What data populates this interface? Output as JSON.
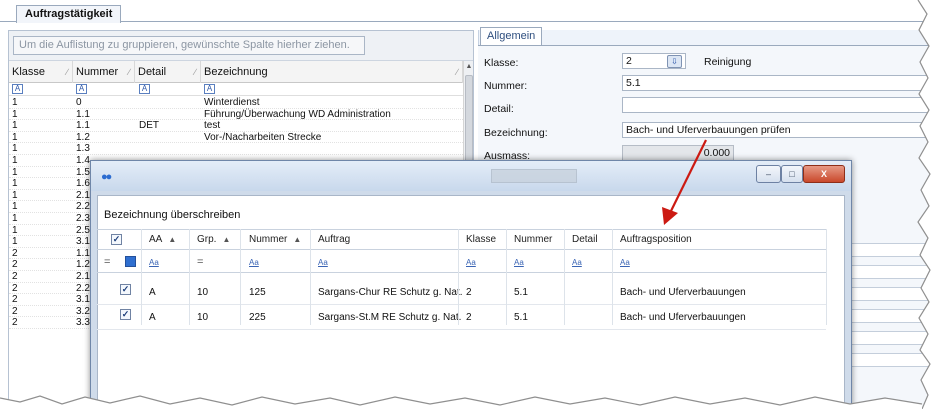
{
  "tabs": {
    "main": "Auftragstätigkeit"
  },
  "left_grid": {
    "group_hint": "Um die Auflistung zu gruppieren, gewünschte Spalte hierher ziehen.",
    "columns": [
      "Klasse",
      "Nummer",
      "Detail",
      "Bezeichnung"
    ],
    "filter_glyph": "A",
    "rows": [
      [
        "1",
        "0",
        "",
        "Winterdienst"
      ],
      [
        "1",
        "1.1",
        "",
        "Führung/Überwachung WD Administration"
      ],
      [
        "1",
        "1.1",
        "DET",
        "test"
      ],
      [
        "1",
        "1.2",
        "",
        "Vor-/Nacharbeiten Strecke"
      ],
      [
        "1",
        "1.3",
        "",
        ""
      ],
      [
        "1",
        "1.4",
        "",
        ""
      ],
      [
        "1",
        "1.5",
        "",
        ""
      ],
      [
        "1",
        "1.6",
        "",
        ""
      ],
      [
        "1",
        "2.1",
        "",
        ""
      ],
      [
        "1",
        "2.2",
        "",
        ""
      ],
      [
        "1",
        "2.3",
        "",
        ""
      ],
      [
        "1",
        "2.5",
        "",
        ""
      ],
      [
        "1",
        "3.1",
        "",
        ""
      ],
      [
        "2",
        "1.1",
        "",
        ""
      ],
      [
        "2",
        "1.2",
        "",
        ""
      ],
      [
        "2",
        "2.1",
        "",
        ""
      ],
      [
        "2",
        "2.2",
        "",
        ""
      ],
      [
        "2",
        "3.1",
        "",
        ""
      ],
      [
        "2",
        "3.2",
        "",
        ""
      ],
      [
        "2",
        "3.3",
        "",
        ""
      ]
    ]
  },
  "right_form": {
    "tab": "Allgemein",
    "klasse_label": "Klasse:",
    "klasse_value": "2",
    "klasse_text": "Reinigung",
    "nummer_label": "Nummer:",
    "nummer_value": "5.1",
    "detail_label": "Detail:",
    "detail_value": "",
    "bezeichnung_label": "Bezeichnung:",
    "bezeichnung_value": "Bach- und Uferverbauungen prüfen",
    "ausmass_label": "Ausmass:",
    "ausmass_value": "0.000"
  },
  "dialog": {
    "caption": "Bezeichnung überschreiben",
    "window_buttons": {
      "minimize": "–",
      "maximize": "□",
      "close": "X"
    },
    "columns": [
      "AA",
      "Grp.",
      "Nummer",
      "Auftrag",
      "Klasse",
      "Nummer",
      "Detail",
      "Auftragsposition"
    ],
    "filter_glyph": "Aa",
    "filter_equals": "=",
    "rows": [
      {
        "checked": true,
        "aa": "A",
        "grp": "10",
        "nummer": "125",
        "auftrag": "Sargans-Chur RE Schutz g. Nat.",
        "klasse": "2",
        "pos_nummer": "5.1",
        "detail": "",
        "auftragsposition": "Bach- und Uferverbauungen"
      },
      {
        "checked": true,
        "aa": "A",
        "grp": "10",
        "nummer": "225",
        "auftrag": "Sargans-St.M RE Schutz g. Nat.",
        "klasse": "2",
        "pos_nummer": "5.1",
        "detail": "",
        "auftragsposition": "Bach- und Uferverbauungen"
      }
    ]
  },
  "icons": {
    "dialog_icon": "app-dots-icon",
    "checkbox": "checkbox-checked-icon",
    "sort": "sort-ascending-icon",
    "annotation": "red-arrow-icon"
  },
  "colors": {
    "arrow": "#cc1a12",
    "close_button": "#c9482b",
    "accent": "#2c56a8"
  }
}
